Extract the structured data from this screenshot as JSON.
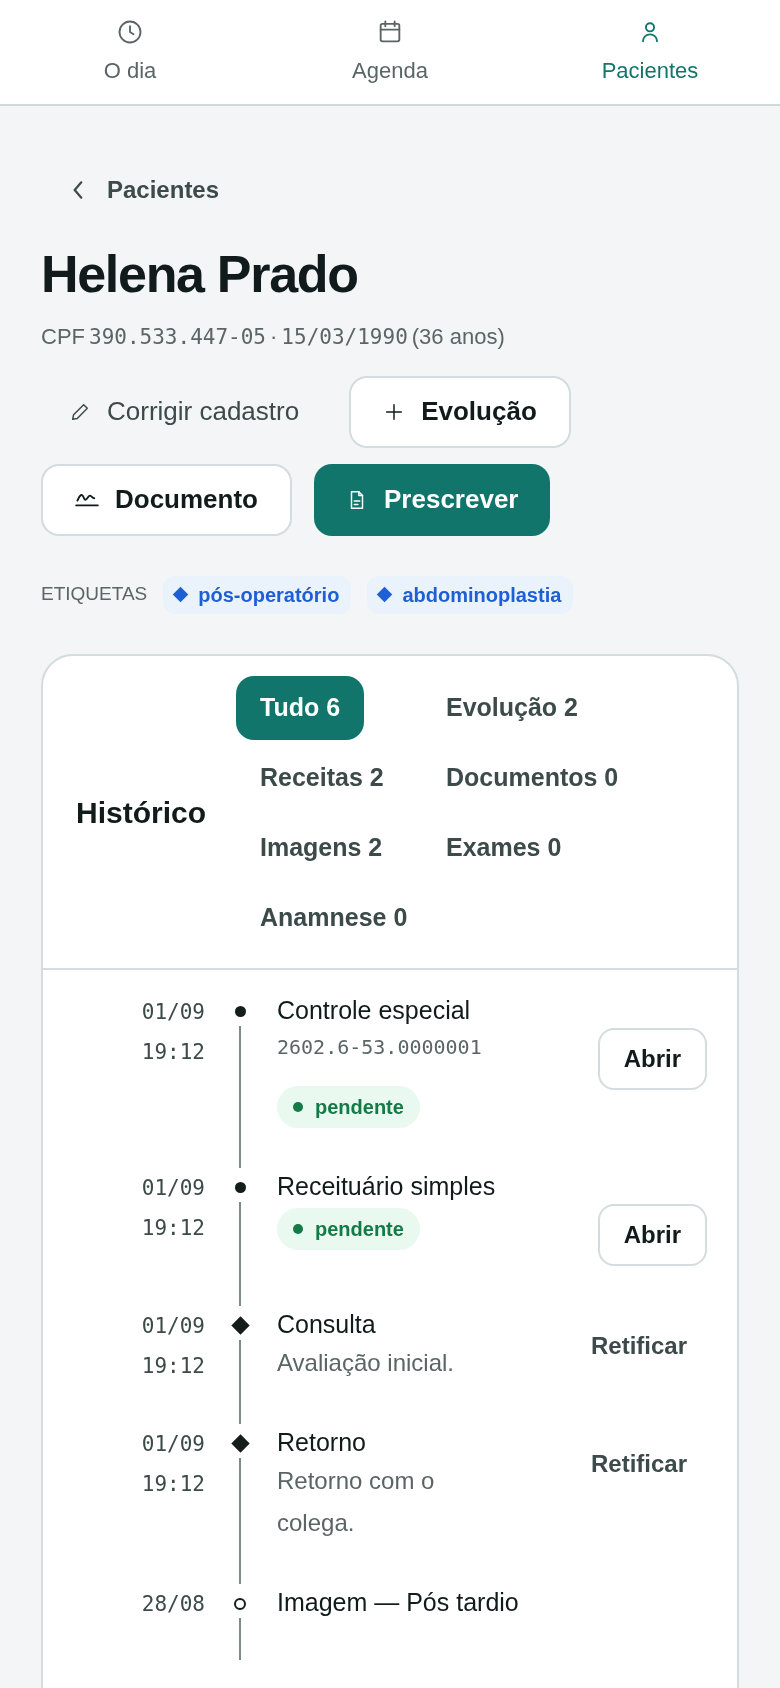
{
  "nav": [
    {
      "label": "O dia",
      "selected": false
    },
    {
      "label": "Agenda",
      "selected": false
    },
    {
      "label": "Pacientes",
      "selected": true
    }
  ],
  "back": {
    "label": "Pacientes"
  },
  "patient": {
    "name": "Helena Prado",
    "cpf_label": "CPF",
    "cpf": "390.533.447-05",
    "separator": "·",
    "birth": "15/03/1990",
    "age": "(36 anos)"
  },
  "actions": [
    {
      "label": "Corrigir cadastro",
      "kind": "ghost"
    },
    {
      "label": "Evolução",
      "kind": "outline"
    },
    {
      "label": "Documento",
      "kind": "outline"
    },
    {
      "label": "Prescrever",
      "kind": "primary"
    }
  ],
  "tags": {
    "label": "ETIQUETAS",
    "items": [
      {
        "label": "pós-operatório",
        "color": "#1f5fd6"
      },
      {
        "label": "abdominoplastia",
        "color": "#1f5fd6"
      }
    ]
  },
  "history": {
    "title": "Histórico",
    "filters": [
      {
        "label": "Tudo 6",
        "selected": true
      },
      {
        "label": "Evolução 2",
        "selected": false
      },
      {
        "label": "Receitas 2",
        "selected": false
      },
      {
        "label": "Documentos 0",
        "selected": false
      },
      {
        "label": "Imagens 2",
        "selected": false
      },
      {
        "label": "Exames 0",
        "selected": false
      },
      {
        "label": "Anamnese 0",
        "selected": false
      }
    ],
    "entries": [
      {
        "date": "01/09",
        "time": "19:12",
        "kind": "dot",
        "title": "Controle especial",
        "code": "2602.6-53.0000001",
        "status": "pendente",
        "action": {
          "kind": "button",
          "label": "Abrir"
        }
      },
      {
        "date": "01/09",
        "time": "19:12",
        "kind": "dot",
        "title": "Receituário simples",
        "status": "pendente",
        "action": {
          "kind": "button",
          "label": "Abrir"
        }
      },
      {
        "date": "01/09",
        "time": "19:12",
        "kind": "diamond",
        "title": "Consulta",
        "note": "Avaliação inicial.",
        "action": {
          "kind": "link",
          "label": "Retificar"
        }
      },
      {
        "date": "01/09",
        "time": "19:12",
        "kind": "diamond",
        "title": "Retorno",
        "note": "Retorno com o colega.",
        "action": {
          "kind": "link",
          "label": "Retificar"
        }
      },
      {
        "date": "28/08",
        "kind": "ring",
        "title": "Imagem — Pós tardio"
      }
    ]
  }
}
